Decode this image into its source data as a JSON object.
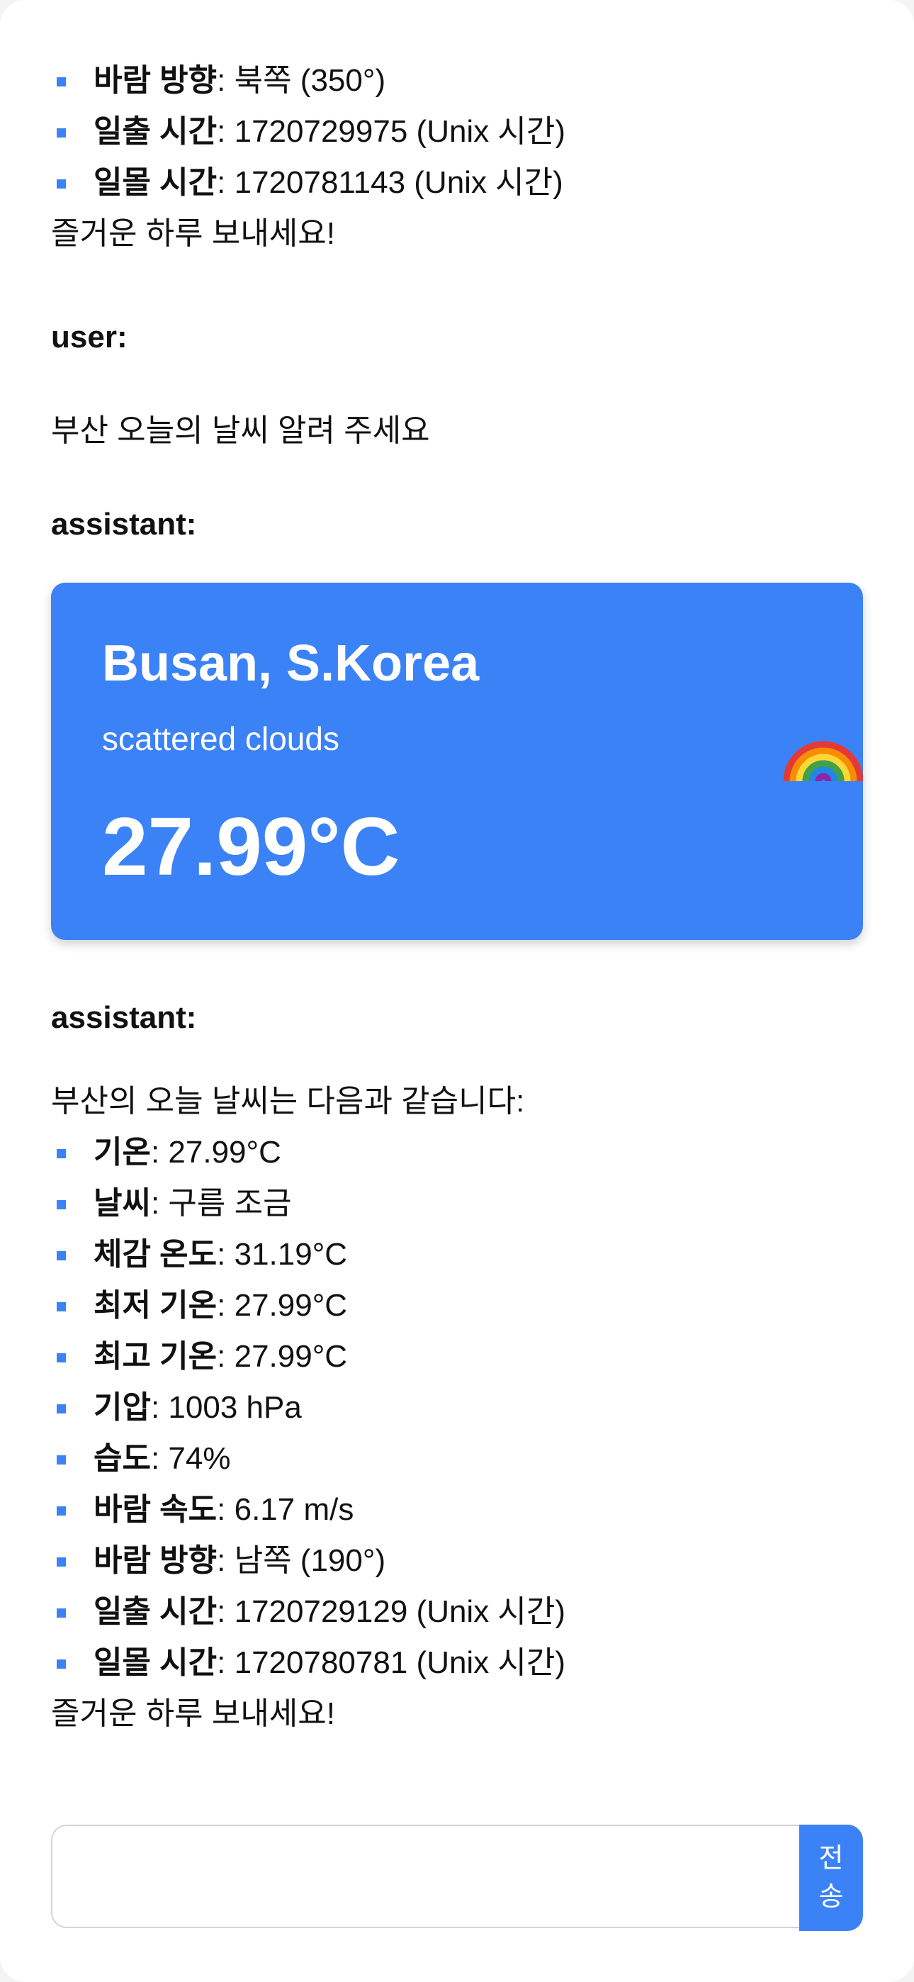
{
  "messages": [
    {
      "facts": [
        {
          "label": "바람 방향",
          "value": ": 북쪽 (350°)"
        },
        {
          "label": "일출 시간",
          "value": ": 1720729975 (Unix 시간)"
        },
        {
          "label": "일몰 시간",
          "value": ": 1720781143 (Unix 시간)"
        }
      ],
      "closing": "즐거운 하루 보내세요!"
    },
    {
      "role": "user:",
      "text": "부산 오늘의 날씨 알려 주세요"
    },
    {
      "role": "assistant:",
      "card": {
        "city": "Busan, S.Korea",
        "description": "scattered clouds",
        "temperature": "27.99°C",
        "icon": "rainbow-icon",
        "color": "#3b82f6"
      }
    },
    {
      "role": "assistant:",
      "intro": "부산의 오늘 날씨는 다음과 같습니다:",
      "facts": [
        {
          "label": "기온",
          "value": ": 27.99°C"
        },
        {
          "label": "날씨",
          "value": ": 구름 조금"
        },
        {
          "label": "체감 온도",
          "value": ": 31.19°C"
        },
        {
          "label": "최저 기온",
          "value": ": 27.99°C"
        },
        {
          "label": "최고 기온",
          "value": ": 27.99°C"
        },
        {
          "label": "기압",
          "value": ": 1003 hPa"
        },
        {
          "label": "습도",
          "value": ": 74%"
        },
        {
          "label": "바람 속도",
          "value": ": 6.17 m/s"
        },
        {
          "label": "바람 방향",
          "value": ": 남쪽 (190°)"
        },
        {
          "label": "일출 시간",
          "value": ": 1720729129 (Unix 시간)"
        },
        {
          "label": "일몰 시간",
          "value": ": 1720780781 (Unix 시간)"
        }
      ],
      "closing": "즐거운 하루 보내세요!"
    }
  ],
  "composer": {
    "value": "",
    "send_label_line1": "전",
    "send_label_line2": "송"
  },
  "theme": {
    "accent": "#3b82f6"
  }
}
